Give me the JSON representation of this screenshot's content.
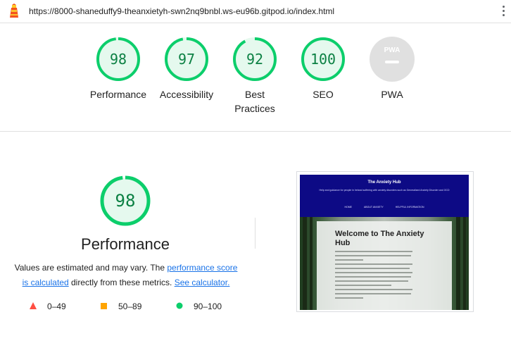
{
  "topbar": {
    "url": "https://8000-shaneduffy9-theanxietyh-swn2nq9bnbl.ws-eu96b.gitpod.io/index.html"
  },
  "colors": {
    "pass": "#0cce6b",
    "pass_fill": "#e5f9ee",
    "pass_text": "#0b8043",
    "average": "#ffa400",
    "fail": "#ff4e42",
    "na": "#e0e0e0",
    "link": "#1a73e8"
  },
  "summary_gauges": [
    {
      "label": "Performance",
      "score": "98",
      "value": 98
    },
    {
      "label": "Accessibility",
      "score": "97",
      "value": 97
    },
    {
      "label": "Best\nPractices",
      "label_line1": "Best",
      "label_line2": "Practices",
      "score": "92",
      "value": 92
    },
    {
      "label": "SEO",
      "score": "100",
      "value": 100
    },
    {
      "label": "PWA",
      "score": "",
      "value": 0
    }
  ],
  "pwa": {
    "badge_text": "PWA"
  },
  "performance": {
    "score": "98",
    "value": 98,
    "title": "Performance",
    "desc_prefix": "Values are estimated and may vary. The ",
    "desc_link1": "performance score",
    "desc_link1b": "is calculated",
    "desc_middle": " directly from these metrics. ",
    "desc_link2": "See calculator.",
    "legend": [
      {
        "shape": "triangle",
        "range": "0–49"
      },
      {
        "shape": "square",
        "range": "50–89"
      },
      {
        "shape": "circle",
        "range": "90–100"
      }
    ]
  },
  "screenshot": {
    "site_title": "The Anxiety Hub",
    "site_subtitle": "Help and guidance for people in Ireland suffering with anxiety disorders such as Generalised Anxiety Disorder and OCD",
    "nav": [
      "HOME",
      "ABOUT ANXIETY",
      "HELPFUL INFORMATION"
    ],
    "heading": "Welcome to The Anxiety Hub"
  }
}
